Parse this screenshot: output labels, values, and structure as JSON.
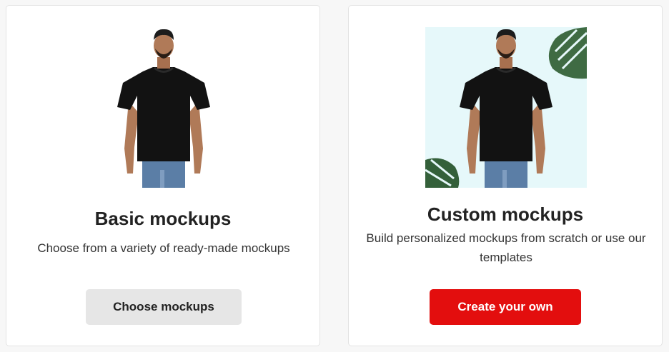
{
  "cards": [
    {
      "title": "Basic mockups",
      "description": "Choose from a variety of ready-made mockups",
      "button_label": "Choose mockups",
      "image": "man-black-tshirt-plain-background"
    },
    {
      "title": "Custom mockups",
      "description": "Build personalized mockups from scratch or use our templates",
      "button_label": "Create your own",
      "image": "man-black-tshirt-with-monstera-leaves"
    }
  ],
  "colors": {
    "primary_button": "#e30e0e",
    "secondary_button": "#e6e6e6",
    "card_background": "#ffffff",
    "page_background": "#f7f7f7",
    "custom_image_background": "#e6f8fa"
  }
}
